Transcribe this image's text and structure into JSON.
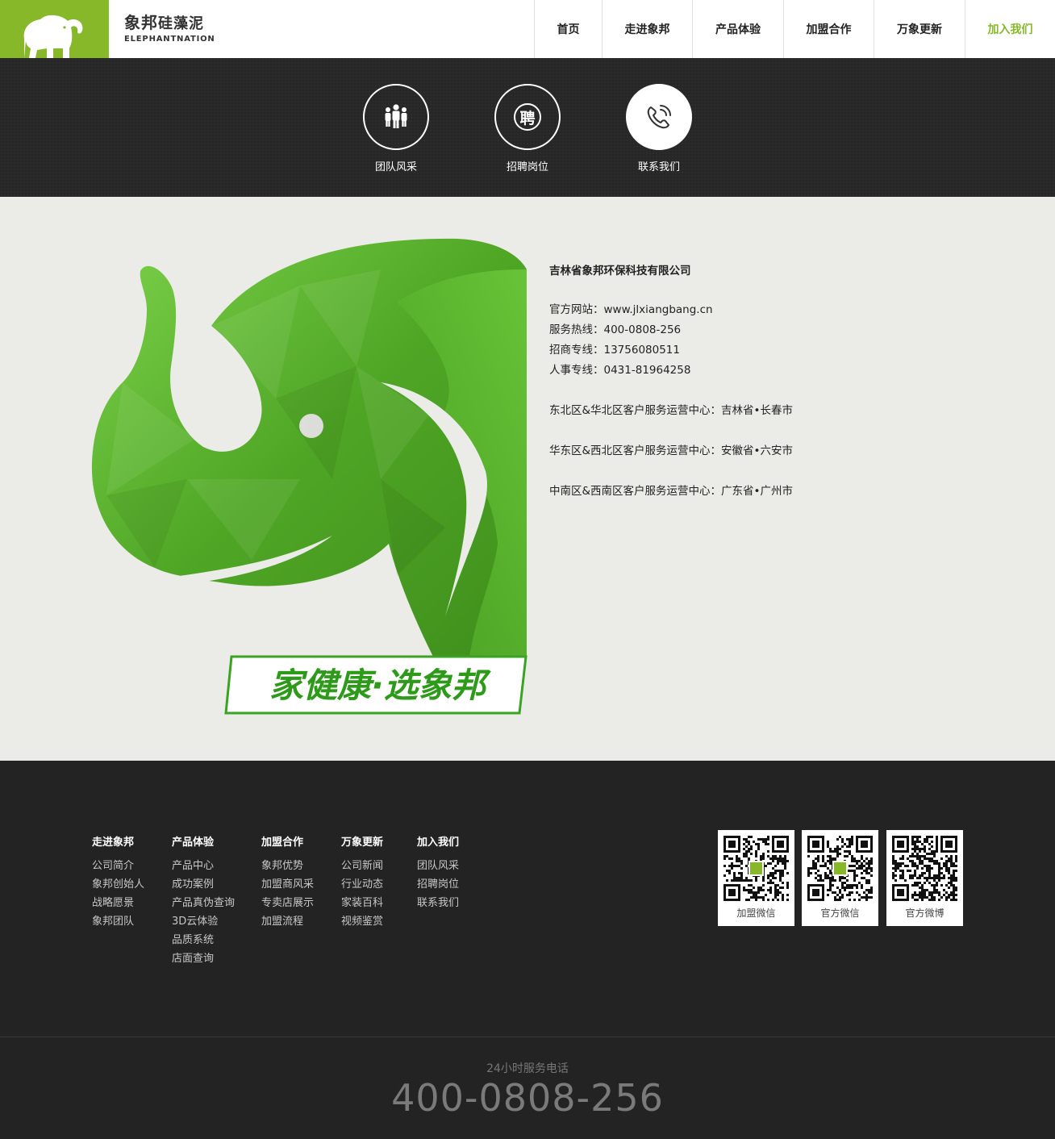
{
  "brand": {
    "name_cn": "象邦",
    "name_sub": "硅藻泥",
    "name_en": "ELEPHANTNATION"
  },
  "nav": [
    {
      "label": "首页",
      "active": false
    },
    {
      "label": "走进象邦",
      "active": false
    },
    {
      "label": "产品体验",
      "active": false
    },
    {
      "label": "加盟合作",
      "active": false
    },
    {
      "label": "万象更新",
      "active": false
    },
    {
      "label": "加入我们",
      "active": true
    }
  ],
  "subnav": [
    {
      "label": "团队风采",
      "icon": "team-icon",
      "active": false
    },
    {
      "label": "招聘岗位",
      "icon": "recruit-icon",
      "icon_text": "聘",
      "active": false
    },
    {
      "label": "联系我们",
      "icon": "phone-icon",
      "active": true
    }
  ],
  "banner_slogan": "家健康·选象邦",
  "contact": {
    "company": "吉林省象邦环保科技有限公司",
    "lines": [
      "官方网站：www.jlxiangbang.cn",
      "服务热线：400-0808-256",
      "招商专线：13756080511",
      "人事专线：0431-81964258"
    ],
    "centers": [
      "东北区&华北区客户服务运营中心：吉林省•长春市",
      "华东区&西北区客户服务运营中心：安徽省•六安市",
      "中南区&西南区客户服务运营中心：广东省•广州市"
    ]
  },
  "footer": {
    "columns": [
      {
        "title": "走进象邦",
        "links": [
          "公司简介",
          "象邦创始人",
          "战略愿景",
          "象邦团队"
        ]
      },
      {
        "title": "产品体验",
        "links": [
          "产品中心",
          "成功案例",
          "产品真伪查询",
          "3D云体验",
          "品质系统",
          "店面查询"
        ]
      },
      {
        "title": "加盟合作",
        "links": [
          "象邦优势",
          "加盟商风采",
          "专卖店展示",
          "加盟流程"
        ]
      },
      {
        "title": "万象更新",
        "links": [
          "公司新闻",
          "行业动态",
          "家装百科",
          "视频鉴赏"
        ]
      },
      {
        "title": "加入我们",
        "links": [
          "团队风采",
          "招聘岗位",
          "联系我们"
        ]
      }
    ],
    "qrcodes": [
      {
        "label": "加盟微信"
      },
      {
        "label": "官方微信"
      },
      {
        "label": "官方微博"
      }
    ],
    "hotline_label": "24小时服务电话",
    "hotline": "400-0808-256"
  },
  "colors": {
    "accent": "#86b82a",
    "dark": "#232323",
    "content_bg": "#ebebe7",
    "elephant_green": "#5cb82e"
  }
}
